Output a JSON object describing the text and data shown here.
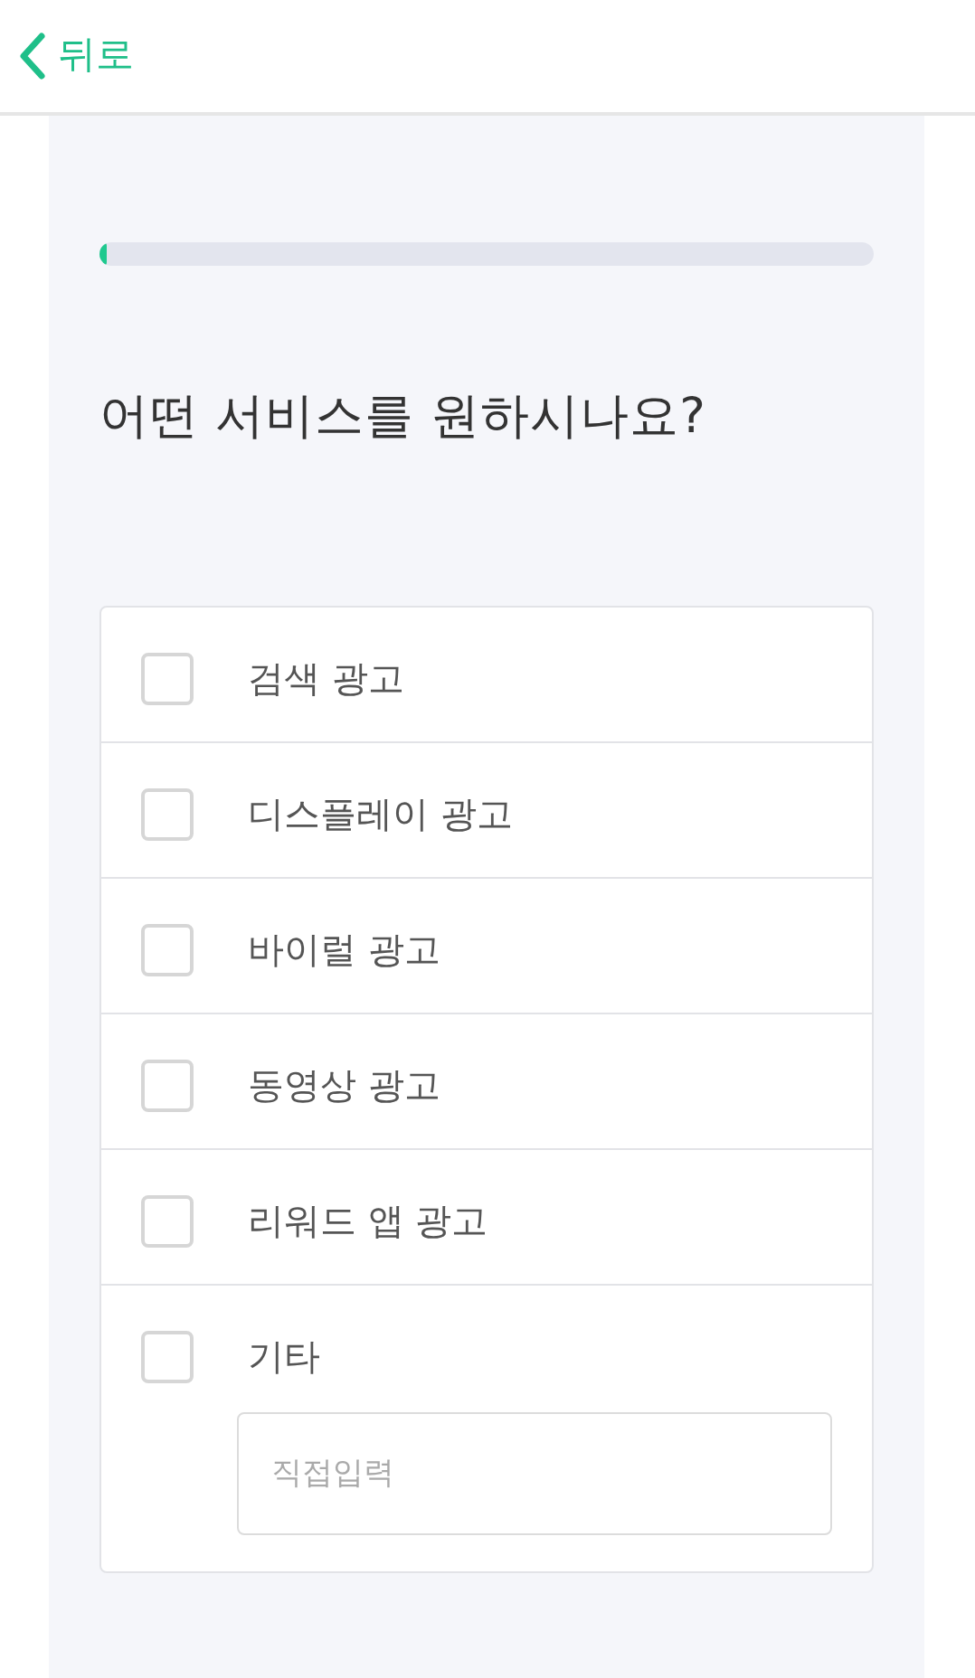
{
  "header": {
    "back_label": "뒤로"
  },
  "progress": {
    "level": 0.01
  },
  "question": "어떤 서비스를 원하시나요?",
  "options": [
    {
      "label": "검색 광고",
      "checked": false,
      "kind": "checkbox"
    },
    {
      "label": "디스플레이 광고",
      "checked": false,
      "kind": "checkbox"
    },
    {
      "label": "바이럴 광고",
      "checked": false,
      "kind": "checkbox"
    },
    {
      "label": "동영상 광고",
      "checked": false,
      "kind": "checkbox"
    },
    {
      "label": "리워드 앱 광고",
      "checked": false,
      "kind": "checkbox"
    },
    {
      "label": "기타",
      "checked": false,
      "kind": "other",
      "placeholder": "직접입력"
    }
  ]
}
